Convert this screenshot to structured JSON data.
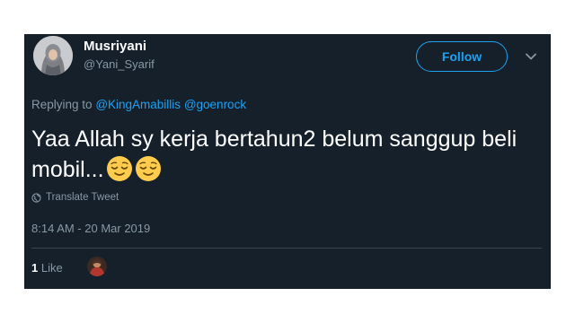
{
  "user": {
    "display_name": "Musriyani",
    "handle": "@Yani_Syarif"
  },
  "follow_label": "Follow",
  "reply": {
    "prefix": "Replying to",
    "mentions": [
      "@KingAmabillis",
      "@goenrock"
    ]
  },
  "tweet": {
    "text": "Yaa Allah sy kerja bertahun2 belum sanggup beli mobil...",
    "emojis": [
      "relieved-face",
      "relieved-face"
    ]
  },
  "translate_label": "Translate Tweet",
  "timestamp": "8:14 AM - 20 Mar 2019",
  "likes": {
    "count": "1",
    "label": "Like"
  },
  "colors": {
    "background": "#15202b",
    "accent": "#1da1f2",
    "muted": "#8899a6"
  }
}
